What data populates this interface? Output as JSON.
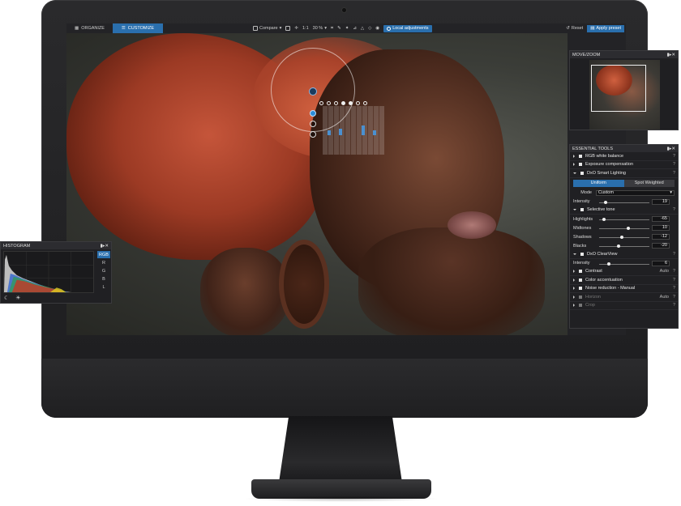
{
  "topbar": {
    "tabs": [
      {
        "label": "ORGANIZE",
        "icon": "grid-icon"
      },
      {
        "label": "CUSTOMIZE",
        "icon": "sliders-icon"
      }
    ],
    "compare_label": "Compare",
    "zoom_fit": "1:1",
    "zoom_level": "30 %",
    "local_adjustments_label": "Local adjustments",
    "reset_label": "Reset",
    "apply_preset_label": "Apply preset"
  },
  "move_zoom": {
    "title": "MOVE/ZOOM"
  },
  "essential_tools": {
    "title": "ESSENTIAL TOOLS",
    "items": [
      {
        "label": "RGB white balance"
      },
      {
        "label": "Exposure compensation"
      },
      {
        "label": "DxO Smart Lighting"
      }
    ],
    "smart_lighting": {
      "modes": [
        "Uniform",
        "Spot Weighted"
      ],
      "mode_label": "Mode",
      "mode_value": "Custom",
      "intensity_label": "Intensity",
      "intensity_value": "19"
    },
    "selective_tone": {
      "label": "Selective tone",
      "rows": [
        {
          "label": "Highlights",
          "value": "-65"
        },
        {
          "label": "Midtones",
          "value": "10"
        },
        {
          "label": "Shadows",
          "value": "-12"
        },
        {
          "label": "Blacks",
          "value": "-20"
        }
      ]
    },
    "clearview": {
      "label": "DxO ClearView",
      "intensity_label": "Intensity",
      "intensity_value": "6"
    },
    "bottom_items": [
      {
        "label": "Contrast",
        "auto": "Auto"
      },
      {
        "label": "Color accentuation",
        "auto": ""
      },
      {
        "label": "Noise reduction - Manual",
        "auto": ""
      },
      {
        "label": "Horizon",
        "auto": "Auto"
      },
      {
        "label": "Crop",
        "auto": ""
      }
    ],
    "help": "?"
  },
  "histogram": {
    "title": "HISTOGRAM",
    "channels": [
      "RGB",
      "R",
      "G",
      "B",
      "L"
    ]
  },
  "colors": {
    "accent": "#2a6fad",
    "panel": "#202023",
    "screen_bg": "#1b1b1d"
  }
}
